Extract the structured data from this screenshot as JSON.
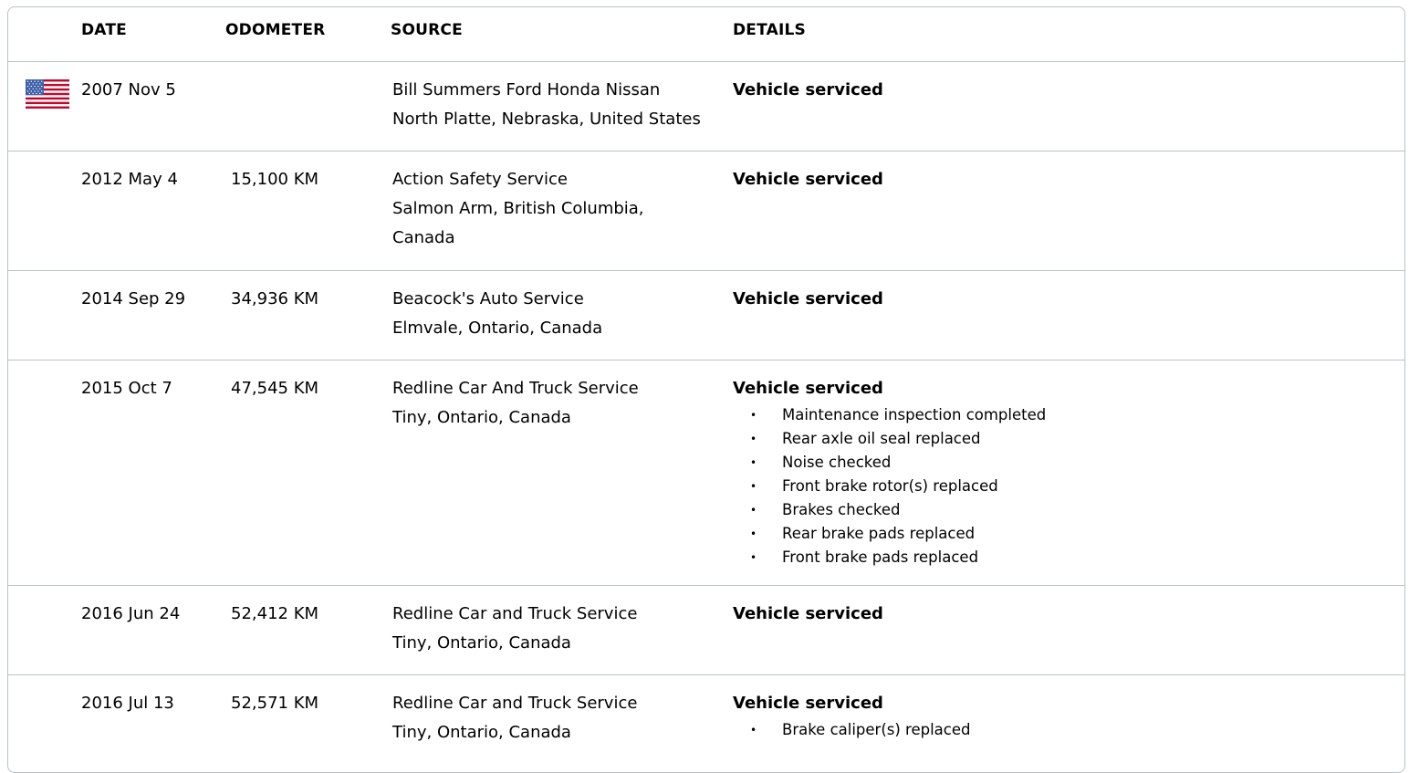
{
  "headers": {
    "date": "DATE",
    "odometer": "ODOMETER",
    "source": "SOURCE",
    "details": "DETAILS"
  },
  "rows": [
    {
      "flag": "us-flag-icon",
      "date": "2007 Nov 5",
      "odometer": "",
      "source": [
        "Bill Summers Ford Honda Nissan",
        "North Platte, Nebraska, United States"
      ],
      "details": {
        "title": "Vehicle serviced",
        "items": []
      }
    },
    {
      "date": "2012 May 4",
      "odometer": "15,100 KM",
      "source": [
        "Action Safety Service",
        "Salmon Arm, British Columbia,",
        "Canada"
      ],
      "details": {
        "title": "Vehicle serviced",
        "items": []
      }
    },
    {
      "date": "2014 Sep 29",
      "odometer": "34,936 KM",
      "source": [
        "Beacock's Auto Service",
        "Elmvale, Ontario, Canada"
      ],
      "details": {
        "title": "Vehicle serviced",
        "items": []
      }
    },
    {
      "date": "2015 Oct 7",
      "odometer": "47,545 KM",
      "source": [
        "Redline Car And Truck Service",
        "Tiny, Ontario, Canada"
      ],
      "details": {
        "title": "Vehicle serviced",
        "items": [
          "Maintenance inspection completed",
          "Rear axle oil seal replaced",
          "Noise checked",
          "Front brake rotor(s) replaced",
          "Brakes checked",
          "Rear brake pads replaced",
          "Front brake pads replaced"
        ]
      }
    },
    {
      "date": "2016 Jun 24",
      "odometer": "52,412 KM",
      "source": [
        "Redline Car and Truck Service",
        "Tiny, Ontario, Canada"
      ],
      "details": {
        "title": "Vehicle serviced",
        "items": []
      }
    },
    {
      "date": "2016 Jul 13",
      "odometer": "52,571 KM",
      "source": [
        "Redline Car and Truck Service",
        "Tiny, Ontario, Canada"
      ],
      "details": {
        "title": "Vehicle serviced",
        "items": [
          "Brake caliper(s) replaced"
        ]
      }
    }
  ],
  "colors": {
    "border": "#b9c2cb",
    "flag_red": "#bf0a30",
    "flag_blue": "#3c5fa8"
  }
}
